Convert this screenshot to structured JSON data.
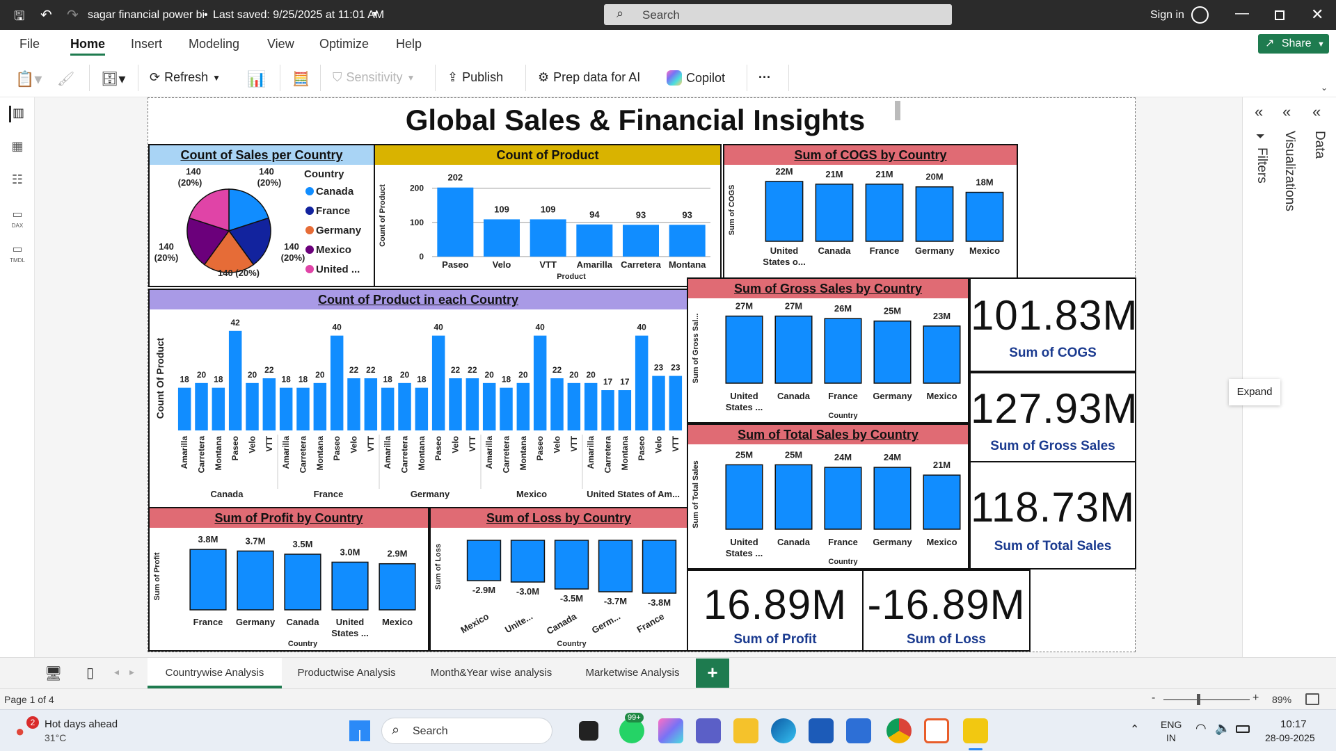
{
  "titlebar": {
    "file_title": "sagar financial power bi",
    "separator": "•",
    "saved": "Last saved: 9/25/2025 at 11:01 AM",
    "search_placeholder": "Search",
    "sign_in": "Sign in"
  },
  "ribbon": {
    "tabs": [
      "File",
      "Home",
      "Insert",
      "Modeling",
      "View",
      "Optimize",
      "Help"
    ],
    "share": "Share"
  },
  "toolbar": {
    "refresh": "Refresh",
    "sensitivity": "Sensitivity",
    "publish": "Publish",
    "prep": "Prep data for AI",
    "copilot": "Copilot",
    "more": "···"
  },
  "leftrail": {
    "dax": "DAX",
    "tmdl": "TMDL"
  },
  "report": {
    "title": "Global Sales & Financial Insights"
  },
  "pie": {
    "title": "Count of Sales per Country",
    "legend_title": "Country",
    "legend": [
      "Canada",
      "France",
      "Germany",
      "Mexico",
      "United ..."
    ],
    "colors": [
      "#118dff",
      "#12239e",
      "#e66c37",
      "#6b007b",
      "#e044a7"
    ],
    "values": [
      140,
      140,
      140,
      140,
      140
    ],
    "labels": [
      "140 (20%)",
      "140 (20%)",
      "140 (20%)",
      "140 (20%)",
      "140 (20%)"
    ]
  },
  "product_chart": {
    "title": "Count of Product",
    "ylabel": "Count of Product",
    "xlabel": "Product",
    "categories": [
      "Paseo",
      "Velo",
      "VTT",
      "Amarilla",
      "Carretera",
      "Montana"
    ],
    "values": [
      202,
      109,
      109,
      94,
      93,
      93
    ],
    "ticks": [
      "0",
      "100",
      "200"
    ]
  },
  "cogs_chart": {
    "title": "Sum of COGS by Country",
    "ylabel": "Sum of COGS",
    "categories": [
      "United States o...",
      "Canada",
      "France",
      "Germany",
      "Mexico"
    ],
    "labels": [
      "22M",
      "21M",
      "21M",
      "20M",
      "18M"
    ],
    "values": [
      22,
      21,
      21,
      20,
      18
    ]
  },
  "gross_chart": {
    "title": "Sum of Gross Sales by Country",
    "ylabel": "Sum of Gross Sal...",
    "xlabel": "Country",
    "categories": [
      "United States ...",
      "Canada",
      "France",
      "Germany",
      "Mexico"
    ],
    "labels": [
      "27M",
      "27M",
      "26M",
      "25M",
      "23M"
    ],
    "values": [
      27,
      27,
      26,
      25,
      23
    ]
  },
  "total_chart": {
    "title": "Sum of Total Sales by Country",
    "ylabel": "Sum of Total Sales",
    "xlabel": "Country",
    "categories": [
      "United States ...",
      "Canada",
      "France",
      "Germany",
      "Mexico"
    ],
    "labels": [
      "25M",
      "25M",
      "24M",
      "24M",
      "21M"
    ],
    "values": [
      25,
      25,
      24,
      24,
      21
    ]
  },
  "country_product": {
    "title": "Count of Product in each Country",
    "ylabel": "Count Of Product",
    "groups": [
      "Canada",
      "France",
      "Germany",
      "Mexico",
      "United States of Am..."
    ],
    "products": [
      "Amarilla",
      "Carretera",
      "Montana",
      "Paseo",
      "Velo",
      "VTT"
    ],
    "values": [
      [
        18,
        20,
        18,
        42,
        20,
        22
      ],
      [
        18,
        18,
        20,
        40,
        22,
        22
      ],
      [
        18,
        20,
        18,
        40,
        22,
        22
      ],
      [
        20,
        18,
        20,
        40,
        22,
        20
      ],
      [
        20,
        17,
        17,
        40,
        23,
        23
      ]
    ]
  },
  "profit_chart": {
    "title": "Sum of Profit by Country",
    "ylabel": "Sum of Profit",
    "xlabel": "Country",
    "categories": [
      "France",
      "Germany",
      "Canada",
      "United States ...",
      "Mexico"
    ],
    "labels": [
      "3.8M",
      "3.7M",
      "3.5M",
      "3.0M",
      "2.9M"
    ],
    "values": [
      3.8,
      3.7,
      3.5,
      3.0,
      2.9
    ]
  },
  "loss_chart": {
    "title": "Sum of Loss by Country",
    "ylabel": "Sum of Loss",
    "xlabel": "Country",
    "categories": [
      "Mexico",
      "Unite...",
      "Canada",
      "Germ...",
      "France"
    ],
    "labels": [
      "-2.9M",
      "-3.0M",
      "-3.5M",
      "-3.7M",
      "-3.8M"
    ],
    "values": [
      -2.9,
      -3.0,
      -3.5,
      -3.7,
      -3.8
    ]
  },
  "kpis": {
    "cogs_value": "101.83M",
    "cogs_label": "Sum of COGS",
    "gross_value": "127.93M",
    "gross_label": "Sum of Gross Sales",
    "total_value": "118.73M",
    "total_label": "Sum of Total  Sales",
    "profit_value": "16.89M",
    "profit_label": "Sum of Profit",
    "loss_value": "-16.89M",
    "loss_label": "Sum of Loss"
  },
  "rightpanel": {
    "filters": "Filters",
    "visualizations": "Visualizations",
    "data": "Data",
    "expand": "Expand"
  },
  "pagetabs": {
    "tabs": [
      "Countrywise Analysis",
      "Productwise Analysis",
      "Month&Year wise analysis",
      "Marketwise Analysis"
    ],
    "add": "+"
  },
  "status": {
    "page": "Page 1 of 4",
    "zoom": "89%",
    "minus": "-",
    "plus": "+"
  },
  "taskbar": {
    "weather_badge": "2",
    "weather_title": "Hot days ahead",
    "weather_temp": "31°C",
    "search": "Search",
    "badge": "99+",
    "lang1": "ENG",
    "lang2": "IN",
    "time": "10:17",
    "date": "28-09-2025"
  },
  "colors": {
    "bar": "#118dff",
    "header_blue": "#a9d4f5",
    "header_yellow": "#d9b300",
    "header_red": "#e06b74",
    "header_purple": "#a99ae6",
    "green": "#1e7b4f"
  }
}
